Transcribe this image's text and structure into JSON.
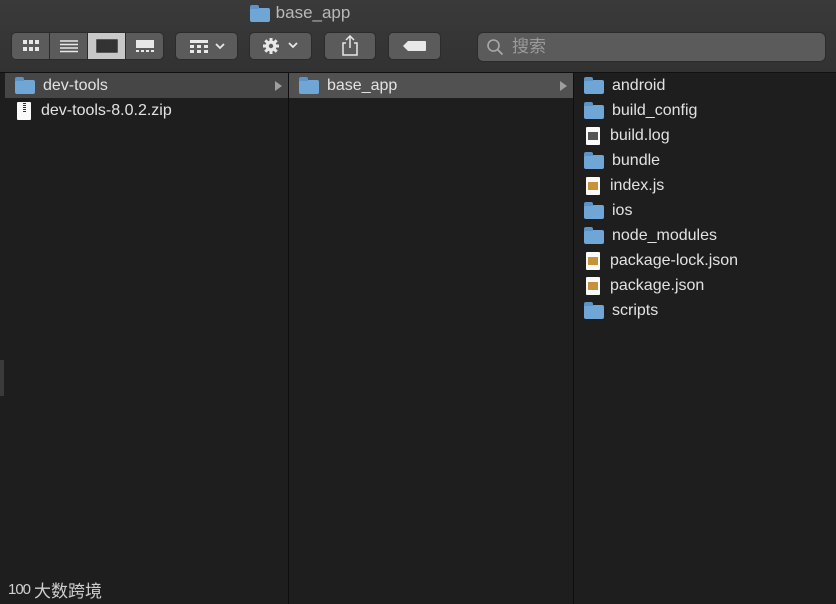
{
  "window": {
    "title": "base_app"
  },
  "search": {
    "placeholder": "搜索"
  },
  "toolbar": {
    "view_modes": [
      "icon-view",
      "list-view",
      "column-view",
      "gallery-view"
    ],
    "active_view": "column-view"
  },
  "columns": [
    {
      "items": [
        {
          "label": "dev-tools",
          "kind": "folder",
          "selected": true,
          "has_children": true
        },
        {
          "label": "dev-tools-8.0.2.zip",
          "kind": "zip"
        }
      ]
    },
    {
      "items": [
        {
          "label": "base_app",
          "kind": "folder",
          "selected": true,
          "has_children": true
        }
      ]
    },
    {
      "items": [
        {
          "label": "android",
          "kind": "folder"
        },
        {
          "label": "build_config",
          "kind": "folder"
        },
        {
          "label": "build.log",
          "kind": "doc"
        },
        {
          "label": "bundle",
          "kind": "folder"
        },
        {
          "label": "index.js",
          "kind": "doc"
        },
        {
          "label": "ios",
          "kind": "folder"
        },
        {
          "label": "node_modules",
          "kind": "folder"
        },
        {
          "label": "package-lock.json",
          "kind": "doc"
        },
        {
          "label": "package.json",
          "kind": "doc"
        },
        {
          "label": "scripts",
          "kind": "folder"
        }
      ]
    }
  ],
  "watermark": {
    "logo": "100",
    "text": "大数跨境"
  },
  "colors": {
    "folder": "#6fa6d6",
    "selection": "#515151",
    "background": "#1e1e1e"
  }
}
